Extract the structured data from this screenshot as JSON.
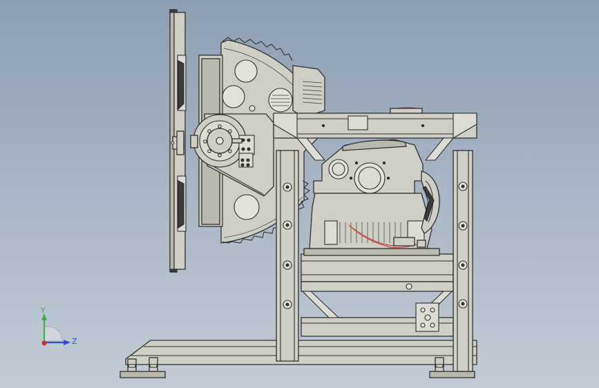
{
  "view": {
    "background_top": "#8d9fb3",
    "background_bottom": "#c3ccd6"
  },
  "triad": {
    "y_label": "Y",
    "z_label": "Z",
    "y_color": "#3fb33f",
    "z_color": "#2a4fd6",
    "origin_color": "#d22b2b"
  }
}
